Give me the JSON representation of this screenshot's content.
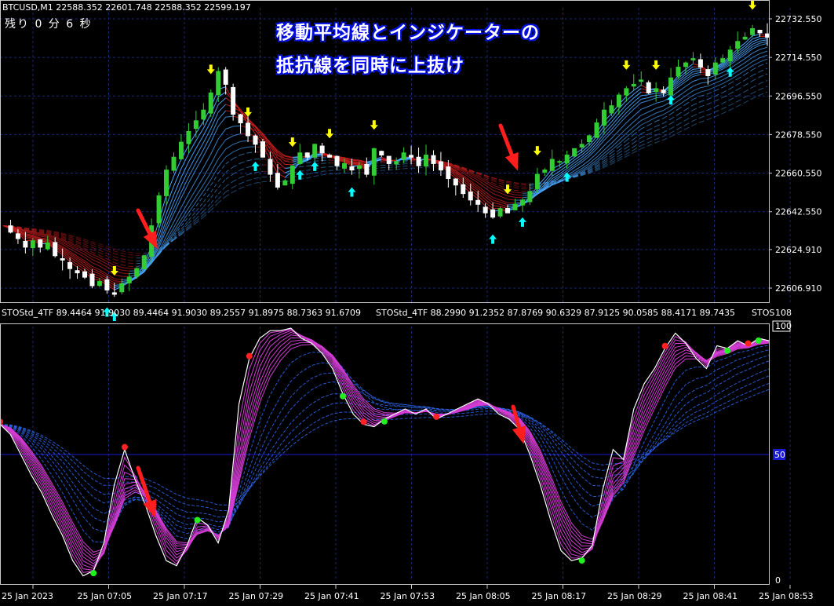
{
  "window": {
    "symbol_line": "BTCUSD,M1  22588.352 22601.748 22588.352 22599.197",
    "remaining": "残り  0 分  6 秒",
    "overlay_line1": "移動平均線とインジケーターの",
    "overlay_line2": "抵抗線を同時に上抜け"
  },
  "indicator_header": {
    "left": "STOStd_4TF 89.4464 91.9030 89.4464 91.9030 89.2557 91.8975 88.7363 91.6709",
    "mid": "STOStd_4TF 88.2990 91.2352 87.8769 90.6329 87.9125 90.0585 88.4171 89.7435",
    "right": "STOS"
  },
  "price_axis": {
    "labels": [
      "22732.550",
      "22714.550",
      "22696.550",
      "22678.550",
      "22660.550",
      "22642.550",
      "22624.910",
      "22606.910"
    ],
    "values": [
      22732.55,
      22714.55,
      22696.55,
      22678.55,
      22660.55,
      22642.55,
      22624.91,
      22606.91
    ]
  },
  "osc_axis": {
    "top": "108",
    "hundred": "100",
    "mid": "50",
    "zero": "0"
  },
  "time_axis": [
    "25 Jan 2023",
    "25 Jan 07:05",
    "25 Jan 07:17",
    "25 Jan 07:29",
    "25 Jan 07:41",
    "25 Jan 07:53",
    "25 Jan 08:05",
    "25 Jan 08:17",
    "25 Jan 08:29",
    "25 Jan 08:41",
    "25 Jan 08:53"
  ],
  "colors": {
    "background": "#000000",
    "grid": "#16286e",
    "bull_candle": "#32cd32",
    "bear_candle": "#ffffff",
    "ma_up": "#4aa8ff",
    "ma_down": "#c81e1e",
    "osc_main": "#ffffff",
    "osc_band": "#d43cd4",
    "osc_slow": "#2a60e0",
    "arrow": "#ff1e1e",
    "signal_up": "#00ffff",
    "signal_down": "#ffff00",
    "dot_green": "#22ee22",
    "dot_red": "#ff2222",
    "level_line": "#1a1ad0"
  },
  "chart_data": [
    {
      "type": "candlestick",
      "title": "BTCUSD,M1",
      "ylim": [
        22600,
        22740
      ],
      "x": [
        "25 Jan 2023",
        "25 Jan 07:05",
        "25 Jan 07:17",
        "25 Jan 07:29",
        "25 Jan 07:41",
        "25 Jan 07:53",
        "25 Jan 08:05",
        "25 Jan 08:17",
        "25 Jan 08:29",
        "25 Jan 08:41",
        "25 Jan 08:53"
      ],
      "close_path": [
        22636,
        22633,
        22630,
        22626,
        22629,
        22626,
        22628,
        22622,
        22620,
        22616,
        22614,
        22612,
        22608,
        22610,
        22606,
        22604,
        22609,
        22612,
        22616,
        22622,
        22636,
        22650,
        22662,
        22668,
        22675,
        22680,
        22685,
        22690,
        22698,
        22708,
        22702,
        22688,
        22684,
        22678,
        22674,
        22668,
        22660,
        22654,
        22657,
        22664,
        22670,
        22668,
        22674,
        22670,
        22668,
        22664,
        22665,
        22662,
        22664,
        22660,
        22672,
        22669,
        22665,
        22666,
        22670,
        22668,
        22664,
        22669,
        22665,
        22662,
        22658,
        22655,
        22651,
        22648,
        22646,
        22642,
        22640,
        22644,
        22642,
        22646,
        22648,
        22652,
        22660,
        22662,
        22667,
        22666,
        22669,
        22672,
        22674,
        22678,
        22684,
        22690,
        22692,
        22697,
        22700,
        22702,
        22704,
        22698,
        22700,
        22698,
        22705,
        22710,
        22712,
        22714,
        22710,
        22706,
        22712,
        22714,
        22718,
        22722,
        22724,
        22728,
        22726,
        22724
      ]
    },
    {
      "type": "line",
      "title": "STOStd_4TF",
      "ylim": [
        0,
        108
      ],
      "levels": [
        0,
        50,
        100
      ],
      "main_path": [
        62,
        58,
        50,
        42,
        35,
        26,
        18,
        8,
        2,
        4,
        15,
        38,
        52,
        40,
        30,
        18,
        8,
        6,
        14,
        25,
        22,
        15,
        28,
        70,
        88,
        96,
        99,
        99,
        100,
        96,
        94,
        90,
        84,
        74,
        66,
        62,
        61,
        64,
        66,
        68,
        66,
        68,
        64,
        66,
        68,
        70,
        72,
        70,
        66,
        64,
        60,
        50,
        38,
        24,
        12,
        8,
        9,
        14,
        36,
        52,
        48,
        68,
        78,
        84,
        92,
        98,
        94,
        88,
        84,
        93,
        92,
        95,
        93,
        96,
        95
      ]
    }
  ]
}
